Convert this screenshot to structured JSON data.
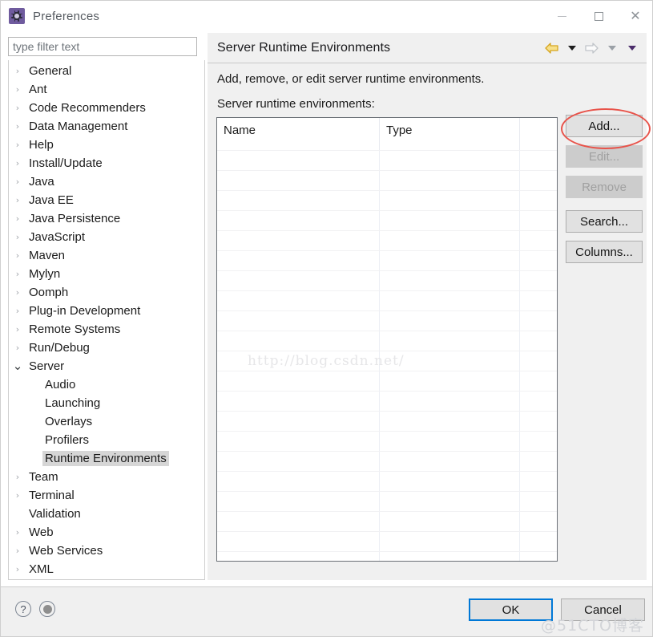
{
  "window": {
    "title": "Preferences",
    "icon": "preferences-gear-icon",
    "controls": {
      "minimize": "minimize-icon",
      "maximize": "maximize-icon",
      "close": "close-icon"
    }
  },
  "filter": {
    "placeholder": "type filter text",
    "value": ""
  },
  "tree": {
    "items": [
      {
        "label": "General",
        "level": 0,
        "twisty": "collapsed",
        "selected": false
      },
      {
        "label": "Ant",
        "level": 0,
        "twisty": "collapsed",
        "selected": false
      },
      {
        "label": "Code Recommenders",
        "level": 0,
        "twisty": "collapsed",
        "selected": false
      },
      {
        "label": "Data Management",
        "level": 0,
        "twisty": "collapsed",
        "selected": false
      },
      {
        "label": "Help",
        "level": 0,
        "twisty": "collapsed",
        "selected": false
      },
      {
        "label": "Install/Update",
        "level": 0,
        "twisty": "collapsed",
        "selected": false
      },
      {
        "label": "Java",
        "level": 0,
        "twisty": "collapsed",
        "selected": false
      },
      {
        "label": "Java EE",
        "level": 0,
        "twisty": "collapsed",
        "selected": false
      },
      {
        "label": "Java Persistence",
        "level": 0,
        "twisty": "collapsed",
        "selected": false
      },
      {
        "label": "JavaScript",
        "level": 0,
        "twisty": "collapsed",
        "selected": false
      },
      {
        "label": "Maven",
        "level": 0,
        "twisty": "collapsed",
        "selected": false
      },
      {
        "label": "Mylyn",
        "level": 0,
        "twisty": "collapsed",
        "selected": false
      },
      {
        "label": "Oomph",
        "level": 0,
        "twisty": "collapsed",
        "selected": false
      },
      {
        "label": "Plug-in Development",
        "level": 0,
        "twisty": "collapsed",
        "selected": false
      },
      {
        "label": "Remote Systems",
        "level": 0,
        "twisty": "collapsed",
        "selected": false
      },
      {
        "label": "Run/Debug",
        "level": 0,
        "twisty": "collapsed",
        "selected": false
      },
      {
        "label": "Server",
        "level": 0,
        "twisty": "expanded",
        "selected": false
      },
      {
        "label": "Audio",
        "level": 1,
        "twisty": "none",
        "selected": false
      },
      {
        "label": "Launching",
        "level": 1,
        "twisty": "none",
        "selected": false
      },
      {
        "label": "Overlays",
        "level": 1,
        "twisty": "none",
        "selected": false
      },
      {
        "label": "Profilers",
        "level": 1,
        "twisty": "none",
        "selected": false
      },
      {
        "label": "Runtime Environments",
        "level": 1,
        "twisty": "none",
        "selected": true
      },
      {
        "label": "Team",
        "level": 0,
        "twisty": "collapsed",
        "selected": false
      },
      {
        "label": "Terminal",
        "level": 0,
        "twisty": "collapsed",
        "selected": false
      },
      {
        "label": "Validation",
        "level": 0,
        "twisty": "none",
        "selected": false
      },
      {
        "label": "Web",
        "level": 0,
        "twisty": "collapsed",
        "selected": false
      },
      {
        "label": "Web Services",
        "level": 0,
        "twisty": "collapsed",
        "selected": false
      },
      {
        "label": "XML",
        "level": 0,
        "twisty": "collapsed",
        "selected": false
      }
    ]
  },
  "pane": {
    "title": "Server Runtime Environments",
    "description": "Add, remove, or edit server runtime environments.",
    "list_label": "Server runtime environments:",
    "nav": {
      "back": "back-arrow-icon",
      "back_menu": "back-history-chevron-icon",
      "forward": "forward-arrow-icon",
      "forward_menu": "forward-history-chevron-icon",
      "view_menu": "view-menu-chevron-icon",
      "back_color": "#e8b530",
      "forward_color": "#c9ccd1",
      "menu_color": "#4b2d6b"
    }
  },
  "table": {
    "columns": [
      "Name",
      "Type",
      ""
    ],
    "rows": [],
    "empty_row_count": 22
  },
  "side_buttons": [
    {
      "label": "Add...",
      "enabled": true,
      "highlighted": true
    },
    {
      "label": "Edit...",
      "enabled": false,
      "highlighted": false
    },
    {
      "label": "Remove",
      "enabled": false,
      "highlighted": false
    },
    {
      "label": "Search...",
      "enabled": true,
      "highlighted": false
    },
    {
      "label": "Columns...",
      "enabled": true,
      "highlighted": false
    }
  ],
  "footer": {
    "help_icon": "help-question-icon",
    "apply_icon": "apply-circle-icon",
    "ok_label": "OK",
    "cancel_label": "Cancel"
  },
  "annotations": {
    "highlight_shape": "red-ellipse-around-add-button",
    "highlight_color": "#e8534a"
  },
  "watermarks": {
    "url": "http://blog.csdn.net/",
    "brand": "@51CTO博客"
  }
}
